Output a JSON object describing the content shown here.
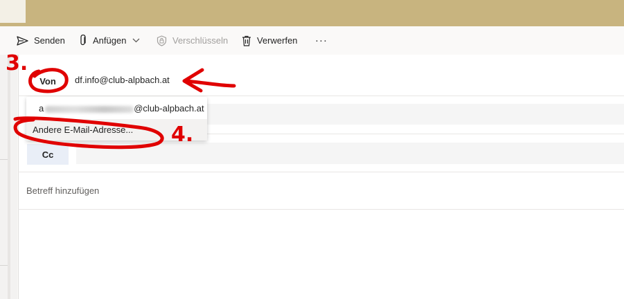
{
  "toolbar": {
    "send": "Senden",
    "attach": "Anfügen",
    "encrypt": "Verschlüsseln",
    "discard": "Verwerfen",
    "more": "···"
  },
  "compose": {
    "from_label": "Von",
    "from_address": "df.info@club-alpbach.at",
    "cc_label": "Cc",
    "subject_placeholder": "Betreff hinzufügen"
  },
  "from_dropdown": {
    "items": [
      {
        "prefix": "a",
        "suffix": "@club-alpbach.at"
      },
      {
        "label": "Andere E-Mail-Adresse..."
      }
    ]
  },
  "annotations": {
    "step3": "3.",
    "step4": "4.",
    "color": "#e00000"
  },
  "colors": {
    "header": "#c8b47f",
    "cc_button": "#e9eef7"
  }
}
